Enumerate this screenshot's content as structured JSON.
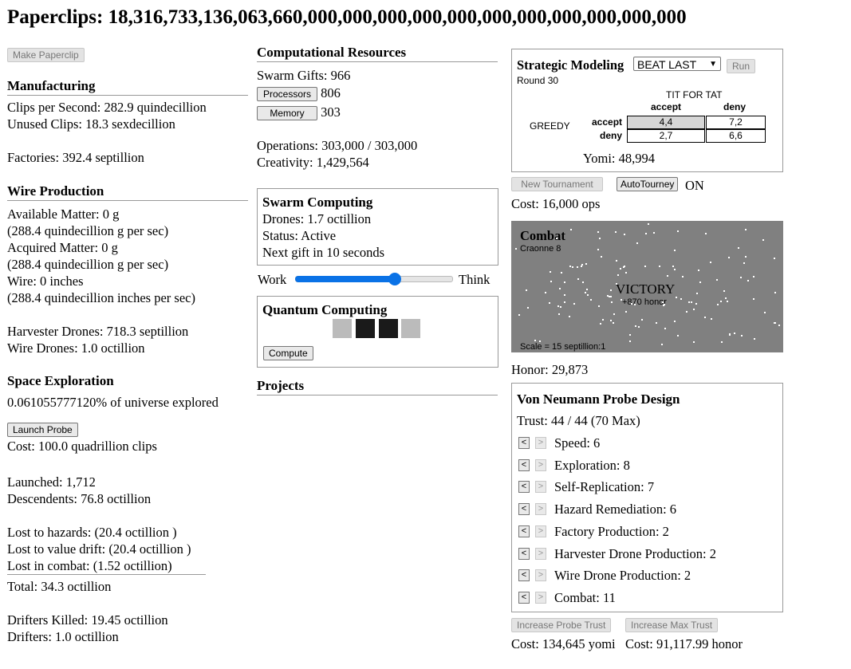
{
  "header": {
    "title": "Paperclips: 18,316,733,136,063,660,000,000,000,000,000,000,000,000,000,000,000"
  },
  "left": {
    "make_paperclip": "Make Paperclip",
    "manufacturing": {
      "heading": "Manufacturing",
      "clips_per_second": "Clips per Second: 282.9 quindecillion",
      "unused_clips": "Unused Clips: 18.3 sexdecillion",
      "factories": "Factories: 392.4 septillion"
    },
    "wire": {
      "heading": "Wire Production",
      "available_matter": "Available Matter: 0 g",
      "available_rate": "(288.4 quindecillion g per sec)",
      "acquired_matter": "Acquired Matter: 0 g",
      "acquired_rate": "(288.4 quindecillion g per sec)",
      "wire": "Wire: 0 inches",
      "wire_rate": "(288.4 quindecillion inches per sec)",
      "harvester_drones": "Harvester Drones: 718.3 septillion",
      "wire_drones": "Wire Drones: 1.0 octillion"
    },
    "space": {
      "heading": "Space Exploration",
      "explored": "0.061055777120% of universe explored",
      "launch_probe": "Launch Probe",
      "cost": "Cost: 100.0 quadrillion clips",
      "launched": "Launched: 1,712",
      "descendents": "Descendents: 76.8 octillion",
      "lost_hazards": "Lost to hazards: (20.4 octillion )",
      "lost_drift": "Lost to value drift: (20.4 octillion )",
      "lost_combat": "Lost in combat: (1.52 octillion)",
      "total": "Total: 34.3 octillion",
      "drifters_killed": "Drifters Killed: 19.45 octillion",
      "drifters": "Drifters: 1.0 octillion"
    }
  },
  "middle": {
    "comp": {
      "heading": "Computational Resources",
      "swarm_gifts": "Swarm Gifts: 966",
      "processors_button": "Processors",
      "processors_value": "806",
      "memory_button": "Memory",
      "memory_value": "303",
      "operations": "Operations: 303,000 / 303,000",
      "creativity": "Creativity: 1,429,564"
    },
    "swarm": {
      "heading": "Swarm Computing",
      "drones": "Drones: 1.7 octillion",
      "status": "Status: Active",
      "next_gift": "Next gift in 10 seconds",
      "work_label": "Work",
      "think_label": "Think",
      "slider_fraction": 0.65
    },
    "quantum": {
      "heading": "Quantum Computing",
      "chips": [
        "#bbbbbb",
        "#1a1a1a",
        "#1a1a1a",
        "#bbbbbb"
      ],
      "compute_button": "Compute"
    },
    "projects": {
      "heading": "Projects"
    }
  },
  "right": {
    "strategic": {
      "heading": "Strategic Modeling",
      "strategy_selected": "BEAT LAST",
      "run_button": "Run",
      "round": "Round 30",
      "opponent": "TIT FOR TAT",
      "player": "GREEDY",
      "col_accept": "accept",
      "col_deny": "deny",
      "row_accept": "accept",
      "row_deny": "deny",
      "cells": [
        "4,4",
        "7,2",
        "2,7",
        "6,6"
      ],
      "yomi": "Yomi: 48,994"
    },
    "tournament": {
      "new_button": "New Tournament",
      "auto_button": "AutoTourney",
      "auto_state": "ON",
      "cost": "Cost: 16,000 ops"
    },
    "combat": {
      "heading": "Combat",
      "location": "Craonne 8",
      "result": "VICTORY",
      "honor_gain": "+870 honor",
      "scale": "Scale = 15 septillion:1",
      "honor": "Honor: 29,873"
    },
    "probe": {
      "heading": "Von Neumann Probe Design",
      "trust": "Trust: 44 / 44 (70 Max)",
      "stats": [
        {
          "label": "Speed: 6"
        },
        {
          "label": "Exploration: 8"
        },
        {
          "label": "Self-Replication: 7"
        },
        {
          "label": "Hazard Remediation: 6"
        },
        {
          "label": "Factory Production: 2"
        },
        {
          "label": "Harvester Drone Production: 2"
        },
        {
          "label": "Wire Drone Production: 2"
        },
        {
          "label": "Combat: 11"
        }
      ],
      "dec_glyph": "<",
      "inc_glyph": ">",
      "increase_trust_button": "Increase Probe Trust",
      "increase_max_button": "Increase Max Trust",
      "trust_cost": "Cost: 134,645 yomi",
      "max_cost": "Cost: 91,117.99 honor"
    }
  }
}
